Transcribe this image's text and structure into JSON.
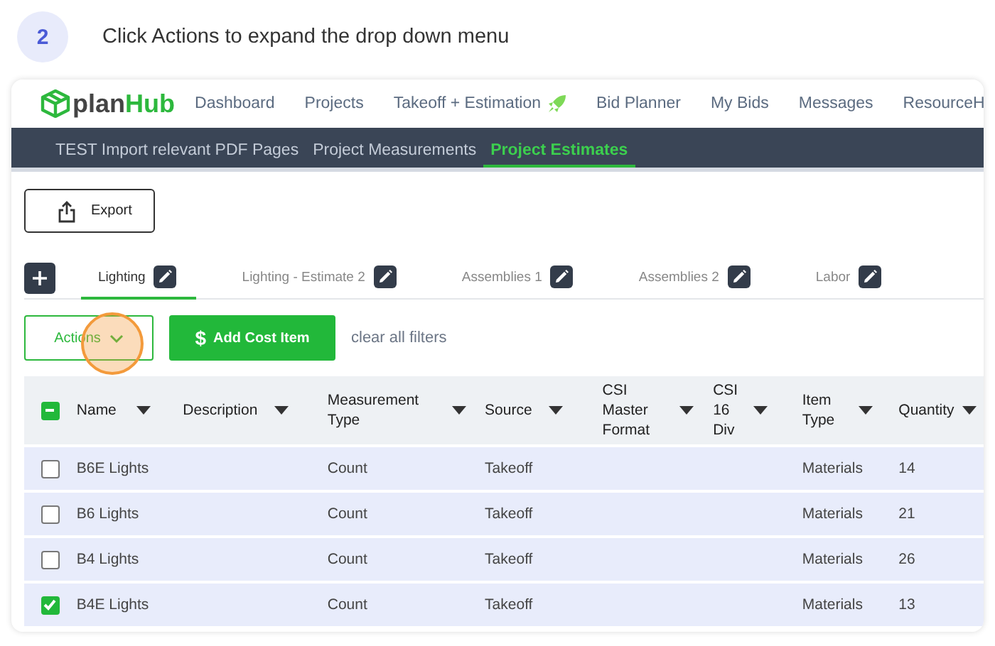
{
  "step": {
    "number": "2",
    "instruction": "Click Actions to expand the drop down menu"
  },
  "logo": {
    "part_1": "plan",
    "part_2": "Hub"
  },
  "nav": [
    {
      "label": "Dashboard",
      "kind": "text"
    },
    {
      "label": "Projects",
      "kind": "text"
    },
    {
      "label": "Takeoff + Estimation",
      "kind": "featured"
    },
    {
      "label": "Bid Planner",
      "kind": "text"
    },
    {
      "label": "My Bids",
      "kind": "text"
    },
    {
      "label": "Messages",
      "kind": "text"
    },
    {
      "label": "ResourceH",
      "kind": "text"
    }
  ],
  "subtabs": [
    {
      "label": "TEST Import relevant PDF Pages",
      "selected": false
    },
    {
      "label": "Project Measurements",
      "selected": false
    },
    {
      "label": "Project Estimates",
      "selected": true
    }
  ],
  "export_button": "Export",
  "estimate_tabs": [
    {
      "label": "Lighting",
      "selected": true
    },
    {
      "label": "Lighting - Estimate 2",
      "selected": false
    },
    {
      "label": "Assemblies 1",
      "selected": false
    },
    {
      "label": "Assemblies 2",
      "selected": false
    },
    {
      "label": "Labor",
      "selected": false
    }
  ],
  "actions_button": "Actions",
  "add_button": {
    "icon": "$",
    "label": "Add Cost Item"
  },
  "clear_filters": "clear all filters",
  "table": {
    "select_all_partial": true,
    "columns": [
      "Name",
      "Description",
      "Measurement Type",
      "Source",
      "CSI Master Format",
      "CSI 16 Div",
      "Item Type",
      "Quantity"
    ],
    "rows": [
      {
        "checked": false,
        "cells": [
          "B6E Lights",
          "",
          "Count",
          "Takeoff",
          "",
          "",
          "Materials",
          "14"
        ]
      },
      {
        "checked": false,
        "cells": [
          "B6 Lights",
          "",
          "Count",
          "Takeoff",
          "",
          "",
          "Materials",
          "21"
        ]
      },
      {
        "checked": false,
        "cells": [
          "B4 Lights",
          "",
          "Count",
          "Takeoff",
          "",
          "",
          "Materials",
          "26"
        ]
      },
      {
        "checked": true,
        "cells": [
          "B4E Lights",
          "",
          "Count",
          "Takeoff",
          "",
          "",
          "Materials",
          "13"
        ]
      }
    ]
  }
}
